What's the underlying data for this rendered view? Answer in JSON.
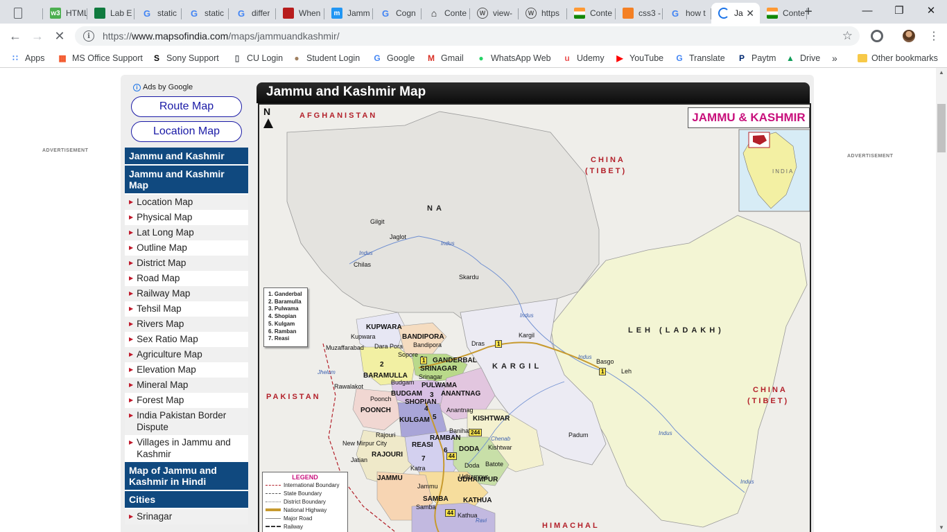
{
  "browser": {
    "tabs": [
      {
        "title": "",
        "icon": "document-icon",
        "color": "#5f6368"
      },
      {
        "title": "HTML",
        "icon": "w3schools-icon",
        "color": "#4caf50"
      },
      {
        "title": "Lab E",
        "icon": "classroom-icon",
        "color": "#0f7a3e"
      },
      {
        "title": "static",
        "icon": "google-icon",
        "color": "#4285f4"
      },
      {
        "title": "static",
        "icon": "google-icon",
        "color": "#4285f4"
      },
      {
        "title": "differ",
        "icon": "google-icon",
        "color": "#4285f4"
      },
      {
        "title": "When",
        "icon": "scale-icon",
        "color": "#b71c1c"
      },
      {
        "title": "Jamm",
        "icon": "m-icon",
        "color": "#2196f3"
      },
      {
        "title": "Cogn",
        "icon": "google-icon",
        "color": "#4285f4"
      },
      {
        "title": "Conte",
        "icon": "home-icon",
        "color": "#222222"
      },
      {
        "title": "view-",
        "icon": "wordpress-icon",
        "color": "#555555"
      },
      {
        "title": "https",
        "icon": "wordpress-icon",
        "color": "#555555"
      },
      {
        "title": "Conte",
        "icon": "india-flag-icon",
        "color": "#ff9933"
      },
      {
        "title": "css3 -",
        "icon": "stackoverflow-icon",
        "color": "#f48024"
      },
      {
        "title": "how t",
        "icon": "google-icon",
        "color": "#4285f4"
      },
      {
        "title": "Ja",
        "icon": "loading-icon",
        "color": "#1a73e8",
        "active": true
      },
      {
        "title": "Conte",
        "icon": "india-flag-icon",
        "color": "#ff9933"
      }
    ],
    "url_prefix": "https://",
    "url_host": "www.mapsofindia.com",
    "url_path": "/maps/jammuandkashmir/",
    "bookmarks": [
      {
        "label": "Apps",
        "icon": "apps-grid-icon",
        "color": "#4285f4"
      },
      {
        "label": "MS Office Support",
        "icon": "microsoft-icon",
        "color": "#f25022"
      },
      {
        "label": "Sony Support",
        "icon": "sony-icon",
        "color": "#000000"
      },
      {
        "label": "CU Login",
        "icon": "document-icon",
        "color": "#5f6368"
      },
      {
        "label": "Student Login",
        "icon": "student-icon",
        "color": "#a08060"
      },
      {
        "label": "Google",
        "icon": "google-icon",
        "color": "#4285f4"
      },
      {
        "label": "Gmail",
        "icon": "gmail-icon",
        "color": "#d93025"
      },
      {
        "label": "WhatsApp Web",
        "icon": "whatsapp-icon",
        "color": "#25d366"
      },
      {
        "label": "Udemy",
        "icon": "udemy-icon",
        "color": "#ec5252"
      },
      {
        "label": "YouTube",
        "icon": "youtube-icon",
        "color": "#ff0000"
      },
      {
        "label": "Translate",
        "icon": "google-icon",
        "color": "#4285f4"
      },
      {
        "label": "Paytm",
        "icon": "paytm-icon",
        "color": "#002970"
      },
      {
        "label": "Drive",
        "icon": "drive-icon",
        "color": "#0f9d58"
      }
    ],
    "bookmarks_overflow": "»",
    "other_bookmarks": "Other bookmarks"
  },
  "page": {
    "advertisement_label": "ADVERTISEMENT",
    "ads_by": "Ads by Google",
    "ad_buttons": [
      "Route Map",
      "Location Map"
    ],
    "sidebar": {
      "section1_title": "Jammu and Kashmir",
      "section2_title": "Jammu and Kashmir Map",
      "links": [
        "Location Map",
        "Physical Map",
        "Lat Long Map",
        "Outline Map",
        "District Map",
        "Road Map",
        "Railway Map",
        "Tehsil Map",
        "Rivers Map",
        "Sex Ratio Map",
        "Agriculture Map",
        "Elevation Map",
        "Mineral Map",
        "Forest Map",
        "India Pakistan Border Dispute",
        "Villages in Jammu and Kashmir"
      ],
      "section3_title": "Map of Jammu and Kashmir in Hindi",
      "section4_title": "Cities",
      "cities": [
        "Srinagar"
      ]
    },
    "map_title": "Jammu and Kashmir Map"
  },
  "map": {
    "state_title": "JAMMU & KASHMIR",
    "inset_label": "INDIA",
    "north": "N",
    "countries": [
      "AFGHANISTAN",
      "CHINA",
      "(TIBET)",
      "PAKISTAN",
      "CHINA",
      "(TIBET)",
      "HIMACHAL"
    ],
    "regions": [
      "NA",
      "LEH (LADAKH)",
      "KARGIL"
    ],
    "districts": [
      "KUPWARA",
      "BANDIPORA",
      "GANDERBAL",
      "SRINAGAR",
      "BARAMULLA",
      "PULWAMA",
      "BUDGAM",
      "ANANTNAG",
      "SHOPIAN",
      "POONCH",
      "KULGAM",
      "KISHTWAR",
      "RAMBAN",
      "REASI",
      "RAJOURI",
      "DODA",
      "UDHAMPUR",
      "JAMMU",
      "SAMBA",
      "KATHUA"
    ],
    "towns": [
      "Gilgit",
      "Jaglot",
      "Chilas",
      "Skardu",
      "Kupwara",
      "Dara Pora",
      "Bandipora",
      "Sopore",
      "Muzaffarabad",
      "Rawalakot",
      "Budgam",
      "Srinagar",
      "Poonch",
      "Rajouri",
      "New Mirpur City",
      "Jatian",
      "Anantnag",
      "Banihal",
      "Kishtwar",
      "Doda",
      "Batote",
      "Katra",
      "Udhampur",
      "Jammu",
      "Samba",
      "Kathua",
      "Dras",
      "Kargil",
      "Basgo",
      "Leh",
      "Padum"
    ],
    "rivers": [
      "Indus",
      "Indus",
      "Indus",
      "Indus",
      "Indus",
      "Indus",
      "Jhelum",
      "Chenab",
      "Ravi"
    ],
    "district_numbers": [
      "1",
      "2",
      "3",
      "4",
      "5",
      "6",
      "7"
    ],
    "highway_numbers": [
      "1",
      "1",
      "1",
      "244",
      "44",
      "44"
    ],
    "legend_key_title": "",
    "legend_key": [
      "1. Ganderbal",
      "2. Baramulla",
      "3. Pulwama",
      "4. Shopian",
      "5. Kulgam",
      "6. Ramban",
      "7. Reasi"
    ],
    "legend_title": "LEGEND",
    "legend_items": [
      "International Boundary",
      "State Boundary",
      "District Boundary",
      "National Highway",
      "Major Road",
      "Railway"
    ]
  }
}
